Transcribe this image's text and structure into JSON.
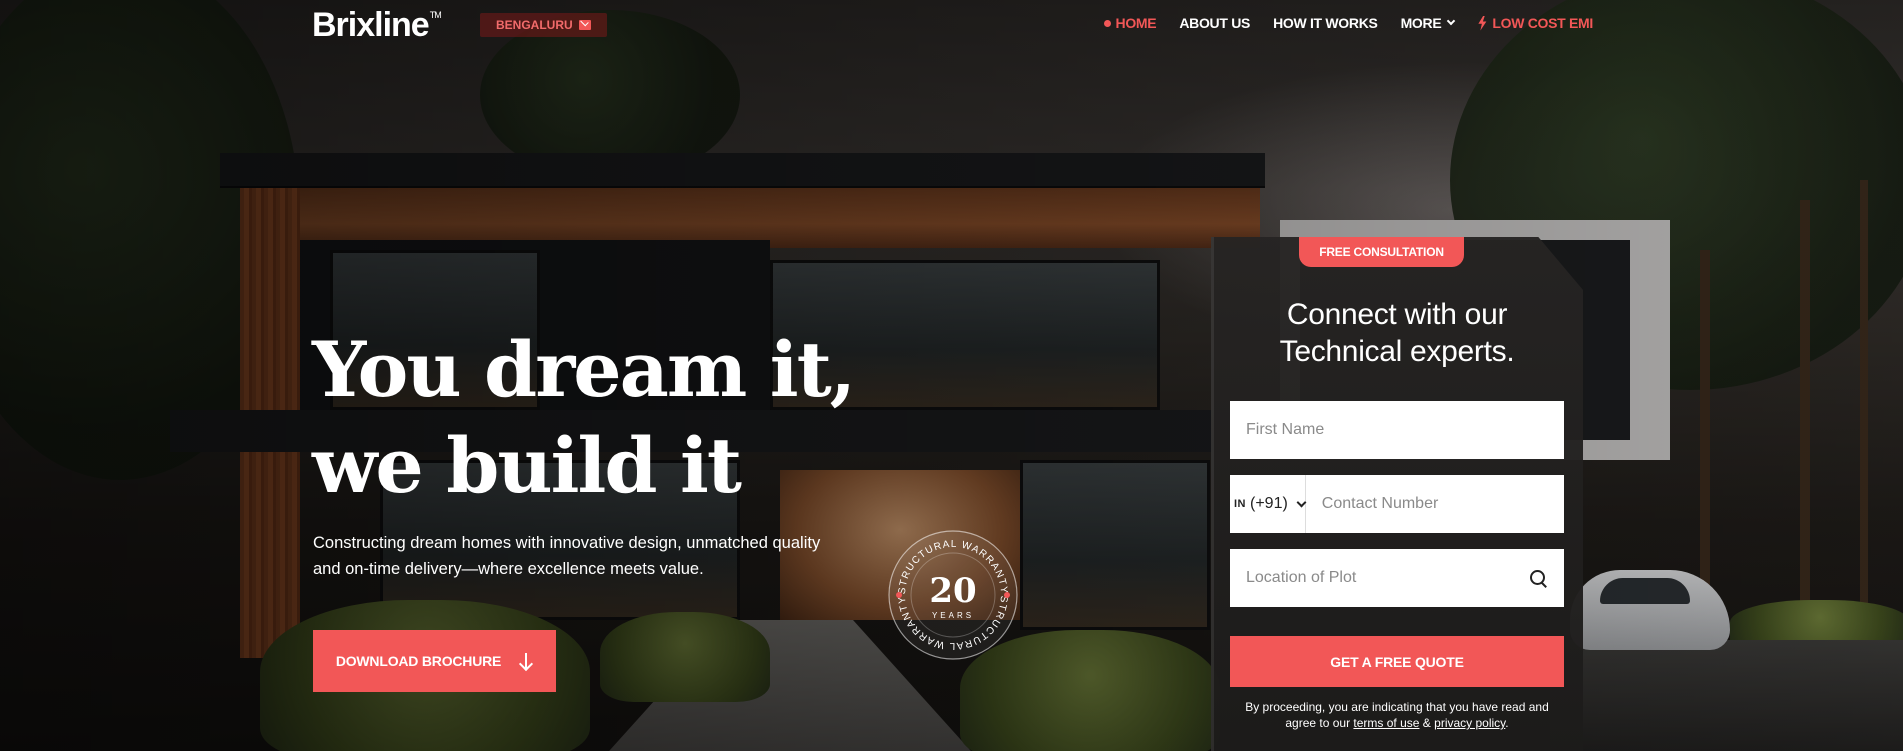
{
  "brand": {
    "name": "Brixline",
    "tm": "TM",
    "accent": "#f25757"
  },
  "city": {
    "label": "BENGALURU",
    "icon": "mail-icon"
  },
  "nav": {
    "items": [
      {
        "label": "HOME",
        "active": true
      },
      {
        "label": "ABOUT US"
      },
      {
        "label": "HOW IT WORKS"
      },
      {
        "label": "MORE",
        "icon": "chevron-down-icon"
      },
      {
        "label": "LOW COST EMI",
        "icon": "bolt-icon"
      }
    ]
  },
  "hero": {
    "line1": "You dream it,",
    "line2": "we build it",
    "subtitle_line1": "Constructing dream homes with innovative design, unmatched quality",
    "subtitle_line2": "and on-time delivery—where excellence meets value.",
    "cta": "DOWNLOAD BROCHURE",
    "cta_icon": "arrow-down-icon"
  },
  "badge": {
    "number": "20",
    "unit": "YEARS",
    "ring_text": "STRUCTURAL WARRANTY"
  },
  "form": {
    "tag": "FREE CONSULTATION",
    "title_line1": "Connect with our",
    "title_line2": "Technical experts.",
    "first_name_placeholder": "First Name",
    "country_iso": "IN",
    "country_code": "(+91)",
    "contact_placeholder": "Contact Number",
    "location_placeholder": "Location of Plot",
    "submit": "GET A FREE QUOTE",
    "legal_pre": "By proceeding, you are indicating that you have read and agree to our",
    "terms": "terms of use",
    "amp": "&",
    "privacy": "privacy policy",
    "end": "."
  }
}
